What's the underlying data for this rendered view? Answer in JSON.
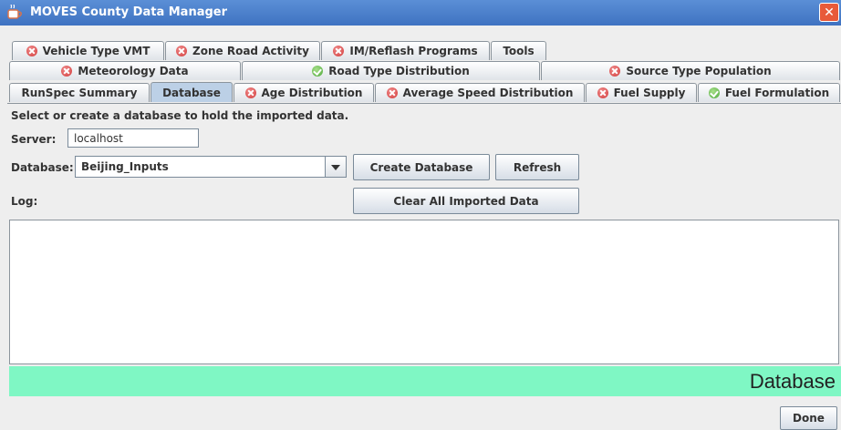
{
  "window": {
    "title": "MOVES County Data Manager"
  },
  "tabs": {
    "row1": [
      {
        "label": "Vehicle Type VMT",
        "status": "error"
      },
      {
        "label": "Zone Road Activity",
        "status": "error"
      },
      {
        "label": "IM/Reflash Programs",
        "status": "error"
      },
      {
        "label": "Tools",
        "status": "none"
      }
    ],
    "row2": [
      {
        "label": "Meteorology Data",
        "status": "error"
      },
      {
        "label": "Road Type Distribution",
        "status": "ok"
      },
      {
        "label": "Source Type Population",
        "status": "error"
      }
    ],
    "row3": [
      {
        "label": "RunSpec Summary",
        "status": "none"
      },
      {
        "label": "Database",
        "status": "none",
        "active": true
      },
      {
        "label": "Age Distribution",
        "status": "error"
      },
      {
        "label": "Average Speed Distribution",
        "status": "error"
      },
      {
        "label": "Fuel Supply",
        "status": "error"
      },
      {
        "label": "Fuel Formulation",
        "status": "ok"
      }
    ]
  },
  "panel": {
    "instruction": "Select or create a database to hold the imported data.",
    "server_label": "Server:",
    "server_value": "localhost",
    "database_label": "Database:",
    "database_value": "Beijing_Inputs",
    "create_button": "Create Database",
    "refresh_button": "Refresh",
    "log_label": "Log:",
    "clear_button": "Clear All Imported Data",
    "log_text": ""
  },
  "status_bar": {
    "text": "Database",
    "color": "#7ff7c4"
  },
  "footer": {
    "done_button": "Done"
  },
  "colors": {
    "title_bar": "#3f72c1",
    "active_tab": "#bcd0e6",
    "error_icon": "#d23a3a",
    "ok_icon": "#4da83a"
  }
}
